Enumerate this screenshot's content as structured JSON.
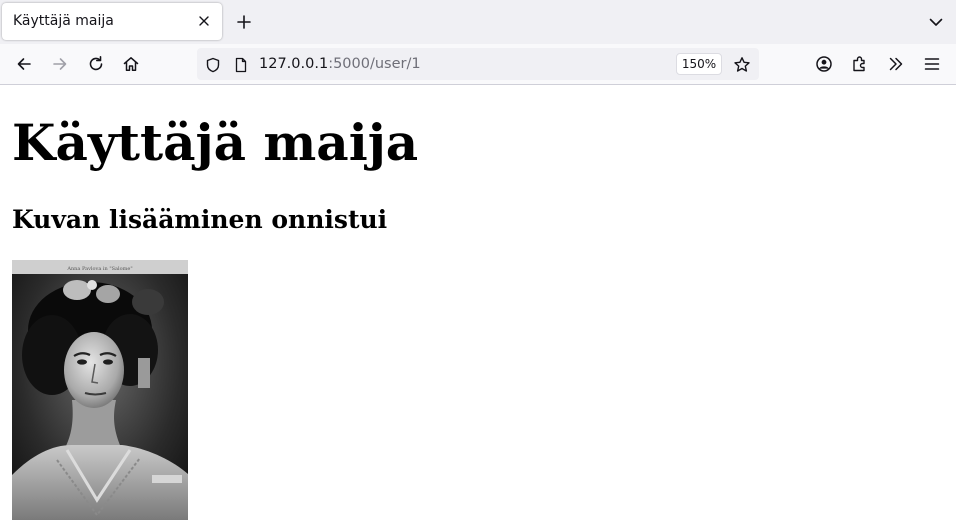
{
  "browser": {
    "tab": {
      "title": "Käyttäjä maija"
    },
    "url": {
      "host": "127.0.0.1",
      "rest": ":5000/user/1"
    },
    "zoom": "150%"
  },
  "icons": {
    "tab_close": "close-icon",
    "new_tab": "plus-icon",
    "tab_list": "chevron-down-icon",
    "back": "arrow-left-icon",
    "forward": "arrow-right-icon",
    "reload": "reload-icon",
    "home": "home-icon",
    "tracking": "shield-icon",
    "page_info": "page-icon",
    "bookmark": "star-icon",
    "account": "account-icon",
    "extensions": "puzzle-icon",
    "overflow": "double-chevron-icon",
    "menu": "hamburger-icon"
  },
  "page": {
    "heading": "Käyttäjä maija",
    "subheading": "Kuvan lisääminen onnistui",
    "photo_caption": "Anna Pavlova in \"Salome\""
  },
  "colors": {
    "tabbar_bg": "#f0f0f4",
    "toolbar_bg": "#f9f9fb",
    "urlbar_bg": "#f0f0f4",
    "page_bg": "#ffffff"
  }
}
